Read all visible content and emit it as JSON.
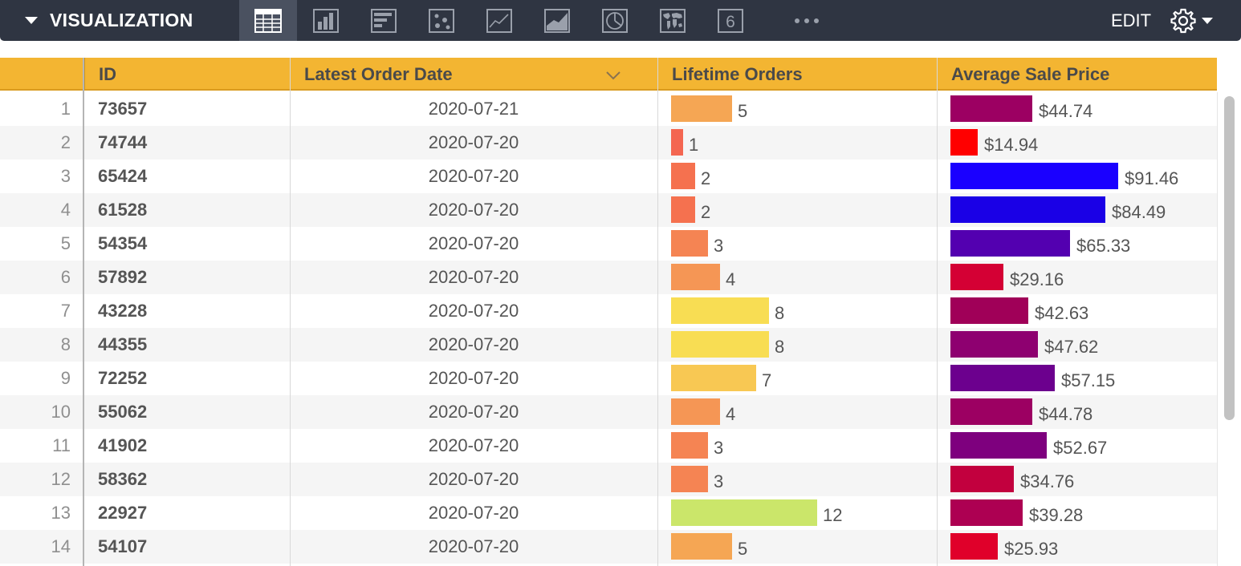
{
  "toolbar": {
    "title": "VISUALIZATION",
    "edit_label": "EDIT",
    "chart_buttons": [
      {
        "name": "table-chart-button",
        "icon": "table-icon",
        "active": true
      },
      {
        "name": "column-chart-button",
        "icon": "column-chart-icon",
        "active": false
      },
      {
        "name": "bar-chart-button",
        "icon": "bar-chart-icon",
        "active": false
      },
      {
        "name": "scatter-chart-button",
        "icon": "scatter-chart-icon",
        "active": false
      },
      {
        "name": "line-chart-button",
        "icon": "line-chart-icon",
        "active": false
      },
      {
        "name": "area-chart-button",
        "icon": "area-chart-icon",
        "active": false
      },
      {
        "name": "pie-chart-button",
        "icon": "pie-chart-icon",
        "active": false
      },
      {
        "name": "map-chart-button",
        "icon": "world-map-icon",
        "active": false
      },
      {
        "name": "single-value-button",
        "icon": "single-value-icon",
        "label": "6",
        "active": false
      },
      {
        "name": "more-charts-button",
        "icon": "more-icon",
        "active": false
      }
    ]
  },
  "table": {
    "columns": {
      "id": "ID",
      "latest_order_date": "Latest Order Date",
      "lifetime_orders": "Lifetime Orders",
      "average_sale_price": "Average Sale Price"
    },
    "sorted_column": "latest_order_date",
    "sort_direction": "descending",
    "rows": [
      {
        "index": "1",
        "id": "73657",
        "date": "2020-07-21",
        "orders": 5,
        "orders_label": "5",
        "orders_color": "#f5a654",
        "price": 44.74,
        "price_label": "$44.74",
        "price_color": "#9c0062"
      },
      {
        "index": "2",
        "id": "74744",
        "date": "2020-07-20",
        "orders": 1,
        "orders_label": "1",
        "orders_color": "#f46651",
        "price": 14.94,
        "price_label": "$14.94",
        "price_color": "#ff0000"
      },
      {
        "index": "3",
        "id": "65424",
        "date": "2020-07-20",
        "orders": 2,
        "orders_label": "2",
        "orders_color": "#f5714f",
        "price": 91.46,
        "price_label": "$91.46",
        "price_color": "#1a00ff"
      },
      {
        "index": "4",
        "id": "61528",
        "date": "2020-07-20",
        "orders": 2,
        "orders_label": "2",
        "orders_color": "#f5714f",
        "price": 84.49,
        "price_label": "$84.49",
        "price_color": "#1a00e6"
      },
      {
        "index": "5",
        "id": "54354",
        "date": "2020-07-20",
        "orders": 3,
        "orders_label": "3",
        "orders_color": "#f58453",
        "price": 65.33,
        "price_label": "$65.33",
        "price_color": "#5300b0"
      },
      {
        "index": "6",
        "id": "57892",
        "date": "2020-07-20",
        "orders": 4,
        "orders_label": "4",
        "orders_color": "#f59655",
        "price": 29.16,
        "price_label": "$29.16",
        "price_color": "#d40034"
      },
      {
        "index": "7",
        "id": "43228",
        "date": "2020-07-20",
        "orders": 8,
        "orders_label": "8",
        "orders_color": "#f8dd53",
        "price": 42.63,
        "price_label": "$42.63",
        "price_color": "#a00058"
      },
      {
        "index": "8",
        "id": "44355",
        "date": "2020-07-20",
        "orders": 8,
        "orders_label": "8",
        "orders_color": "#f8dd53",
        "price": 47.62,
        "price_label": "$47.62",
        "price_color": "#8e0070"
      },
      {
        "index": "9",
        "id": "72252",
        "date": "2020-07-20",
        "orders": 7,
        "orders_label": "7",
        "orders_color": "#f8c853",
        "price": 57.15,
        "price_label": "$57.15",
        "price_color": "#6c008e"
      },
      {
        "index": "10",
        "id": "55062",
        "date": "2020-07-20",
        "orders": 4,
        "orders_label": "4",
        "orders_color": "#f59655",
        "price": 44.78,
        "price_label": "$44.78",
        "price_color": "#9c0062"
      },
      {
        "index": "11",
        "id": "41902",
        "date": "2020-07-20",
        "orders": 3,
        "orders_label": "3",
        "orders_color": "#f58453",
        "price": 52.67,
        "price_label": "$52.67",
        "price_color": "#7e007e"
      },
      {
        "index": "12",
        "id": "58362",
        "date": "2020-07-20",
        "orders": 3,
        "orders_label": "3",
        "orders_color": "#f58453",
        "price": 34.76,
        "price_label": "$34.76",
        "price_color": "#c2003e"
      },
      {
        "index": "13",
        "id": "22927",
        "date": "2020-07-20",
        "orders": 12,
        "orders_label": "12",
        "orders_color": "#cbe66a",
        "price": 39.28,
        "price_label": "$39.28",
        "price_color": "#ad0052"
      },
      {
        "index": "14",
        "id": "54107",
        "date": "2020-07-20",
        "orders": 5,
        "orders_label": "5",
        "orders_color": "#f5a654",
        "price": 25.93,
        "price_label": "$25.93",
        "price_color": "#e0002a"
      }
    ]
  },
  "scale": {
    "orders_max": 12,
    "price_max": 91.46
  }
}
